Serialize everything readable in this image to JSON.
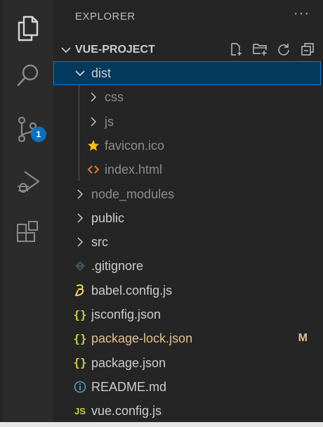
{
  "colors": {
    "folder_text": "#cccccc",
    "muted_text": "#8c8c8c",
    "modified_text": "#e2c08d",
    "json_icon": "#cbcb41",
    "badge": "#0e70c0",
    "selection_bg": "#04395e"
  },
  "activity_bar": {
    "items": [
      {
        "name": "explorer",
        "icon": "files-icon"
      },
      {
        "name": "search",
        "icon": "search-icon"
      },
      {
        "name": "source-control",
        "icon": "source-control-icon",
        "badge": "1"
      },
      {
        "name": "run-debug",
        "icon": "run-debug-icon"
      },
      {
        "name": "extensions",
        "icon": "extensions-icon"
      }
    ]
  },
  "explorer": {
    "title": "EXPLORER",
    "more": "···",
    "section": {
      "title": "VUE-PROJECT",
      "actions": [
        "new-file-icon",
        "new-folder-icon",
        "refresh-icon",
        "collapse-all-icon"
      ]
    },
    "tree": [
      {
        "label": "dist",
        "type": "folder",
        "expanded": true,
        "depth": 0,
        "selected": true
      },
      {
        "label": "css",
        "type": "folder",
        "expanded": false,
        "depth": 1
      },
      {
        "label": "js",
        "type": "folder",
        "expanded": false,
        "depth": 1
      },
      {
        "label": "favicon.ico",
        "type": "file",
        "icon": "star-icon",
        "depth": 1
      },
      {
        "label": "index.html",
        "type": "file",
        "icon": "html-icon",
        "depth": 1
      },
      {
        "label": "node_modules",
        "type": "folder",
        "expanded": false,
        "depth": 0,
        "muted": true
      },
      {
        "label": "public",
        "type": "folder",
        "expanded": false,
        "depth": 0
      },
      {
        "label": "src",
        "type": "folder",
        "expanded": false,
        "depth": 0
      },
      {
        "label": ".gitignore",
        "type": "file",
        "icon": "git-icon",
        "depth": 0
      },
      {
        "label": "babel.config.js",
        "type": "file",
        "icon": "babel-icon",
        "depth": 0
      },
      {
        "label": "jsconfig.json",
        "type": "file",
        "icon": "json-icon",
        "depth": 0
      },
      {
        "label": "package-lock.json",
        "type": "file",
        "icon": "json-icon",
        "depth": 0,
        "modified": true,
        "status": "M"
      },
      {
        "label": "package.json",
        "type": "file",
        "icon": "json-icon",
        "depth": 0
      },
      {
        "label": "README.md",
        "type": "file",
        "icon": "info-icon",
        "depth": 0
      },
      {
        "label": "vue.config.js",
        "type": "file",
        "icon": "js-icon",
        "depth": 0
      }
    ]
  }
}
